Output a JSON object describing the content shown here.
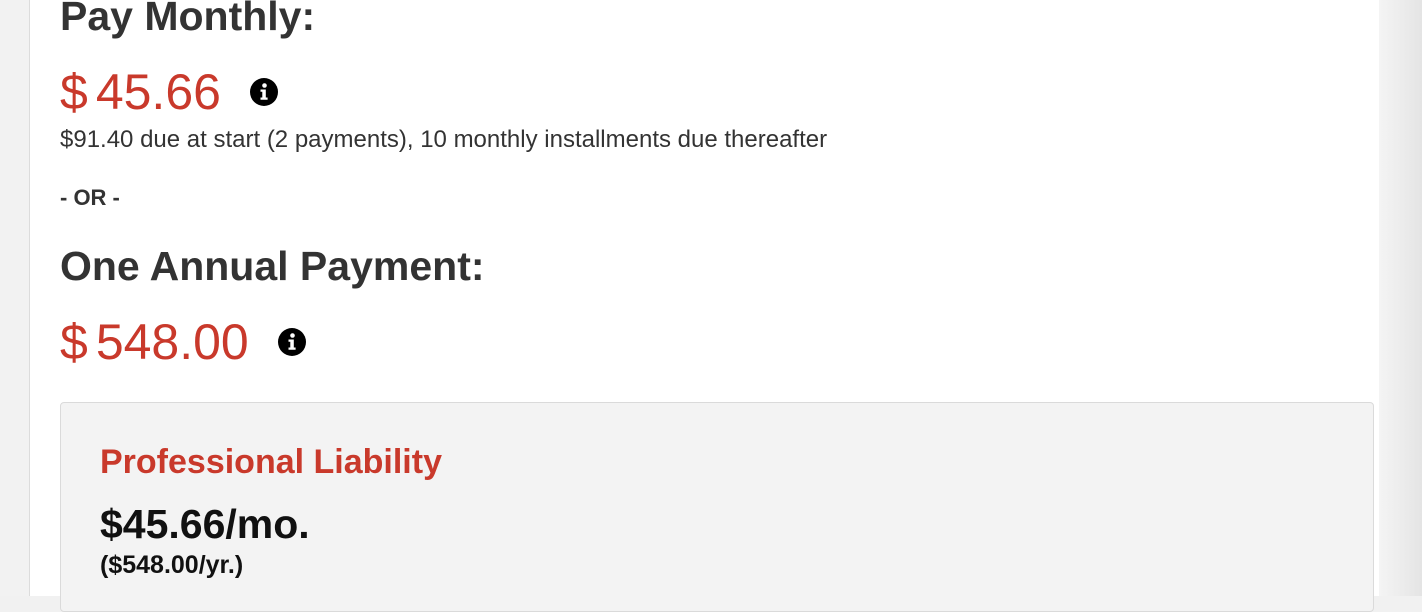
{
  "pay_monthly": {
    "heading": "Pay Monthly:",
    "currency": "$",
    "amount": "45.66",
    "details": "$91.40 due at start (2 payments), 10 monthly installments due thereafter"
  },
  "separator": "- OR -",
  "annual": {
    "heading": "One Annual Payment:",
    "currency": "$",
    "amount": "548.00"
  },
  "coverage_card": {
    "title": "Professional Liability",
    "monthly_price": "$45.66/mo.",
    "yearly_price": "($548.00/yr.)"
  },
  "icons": {
    "info": "info-icon"
  },
  "colors": {
    "price_red": "#c9392b",
    "heading_text": "#333333",
    "card_background": "#f3f3f3"
  }
}
